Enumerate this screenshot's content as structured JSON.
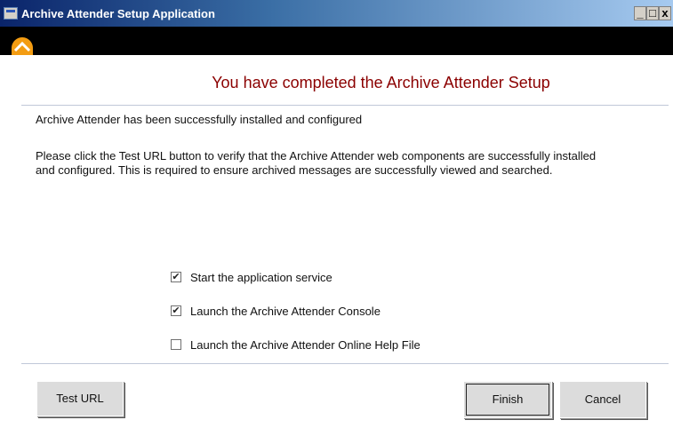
{
  "window": {
    "title": "Archive Attender Setup Application",
    "controls": {
      "minimize": "_",
      "maximize": "□",
      "close": "x"
    }
  },
  "header": {
    "logo_icon": "upward-arrow-logo-icon",
    "heading": "You have completed the Archive Attender Setup"
  },
  "content": {
    "status": "Archive Attender has been successfully installed and configured",
    "instructions": "Please click the Test URL button to verify that the Archive Attender web components are successfully installed and configured. This is required to ensure archived messages are successfully viewed and searched."
  },
  "options": [
    {
      "label": "Start the application service",
      "checked": true
    },
    {
      "label": "Launch the Archive Attender Console",
      "checked": true
    },
    {
      "label": "Launch the Archive Attender Online Help File",
      "checked": false
    }
  ],
  "buttons": {
    "test_url": "Test URL",
    "finish": "Finish",
    "cancel": "Cancel"
  },
  "colors": {
    "heading": "#8b0000",
    "titlebar_start": "#0a246a",
    "titlebar_end": "#a6caf0",
    "logo": "#f39c12"
  }
}
